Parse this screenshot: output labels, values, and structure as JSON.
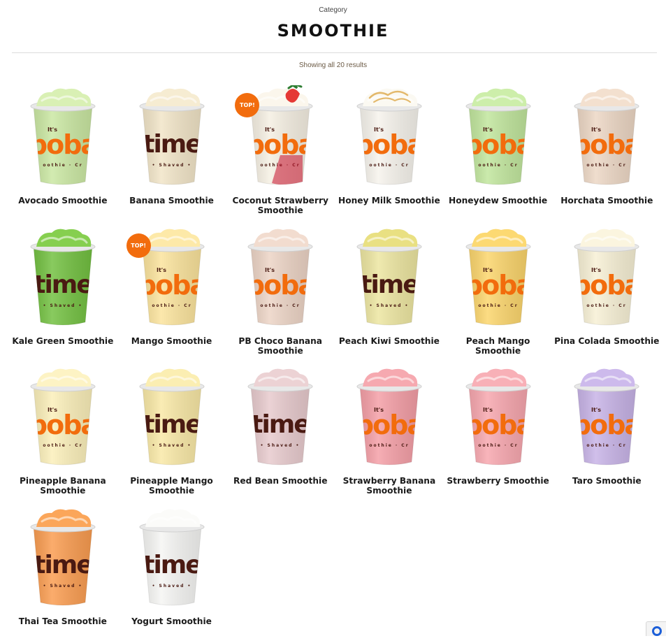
{
  "header": {
    "eyebrow": "Category",
    "title": "SMOOTHIE",
    "results": "Showing all 20 results"
  },
  "brand": {
    "accent": "#f26c0d",
    "dark_brown": "#4a1a12"
  },
  "products": [
    {
      "name": "Avocado Smoothie",
      "color": "#c9e7a0",
      "foam": "#d9f0b4",
      "print": "boba"
    },
    {
      "name": "Banana Smoothie",
      "color": "#f1e4c6",
      "foam": "#f6ecd2",
      "print": "time"
    },
    {
      "name": "Coconut Strawberry Smoothie",
      "color": "#f5efe2",
      "foam": "#fbf6ec",
      "print": "boba",
      "badge": "TOP!",
      "topping": "strawberry"
    },
    {
      "name": "Honey Milk Smoothie",
      "color": "#f6f3ec",
      "foam": "#fbf9f2",
      "print": "boba",
      "topping": "cream"
    },
    {
      "name": "Honeydew Smoothie",
      "color": "#bfe59a",
      "foam": "#cdeeaa",
      "print": "boba"
    },
    {
      "name": "Horchata Smoothie",
      "color": "#ecd6c3",
      "foam": "#f3e0cf",
      "print": "boba"
    },
    {
      "name": "Kale Green Smoothie",
      "color": "#6fbf3c",
      "foam": "#86cf4f",
      "print": "time"
    },
    {
      "name": "Mango Smoothie",
      "color": "#fbe39a",
      "foam": "#fde9a8",
      "print": "boba",
      "badge": "TOP!"
    },
    {
      "name": "PB Choco Banana Smoothie",
      "color": "#ecd3c4",
      "foam": "#f2dccf",
      "print": "boba"
    },
    {
      "name": "Peach Kiwi Smoothie",
      "color": "#ece59e",
      "foam": "#e9e082",
      "print": "time"
    },
    {
      "name": "Peach Mango Smoothie",
      "color": "#fbd468",
      "foam": "#fcd972",
      "print": "boba"
    },
    {
      "name": "Pina Colada Smoothie",
      "color": "#f7f0d4",
      "foam": "#fbf5df",
      "print": "boba"
    },
    {
      "name": "Pineapple Banana Smoothie",
      "color": "#fbefb8",
      "foam": "#fdf3c4",
      "print": "boba"
    },
    {
      "name": "Pineapple Mango Smoothie",
      "color": "#f9e8a4",
      "foam": "#fbeeb2",
      "print": "time"
    },
    {
      "name": "Red Bean Smoothie",
      "color": "#e7c9cc",
      "foam": "#ecd2d4",
      "print": "time"
    },
    {
      "name": "Strawberry Banana Smoothie",
      "color": "#f49ca4",
      "foam": "#f6a9b0",
      "print": "boba"
    },
    {
      "name": "Strawberry Smoothie",
      "color": "#f7a4ac",
      "foam": "#f8b0b7",
      "print": "boba"
    },
    {
      "name": "Taro Smoothie",
      "color": "#c6b1e6",
      "foam": "#cdbaec",
      "print": "boba"
    },
    {
      "name": "Thai Tea Smoothie",
      "color": "#fa9a4c",
      "foam": "#fba65a",
      "print": "time"
    },
    {
      "name": "Yogurt Smoothie",
      "color": "#f5f5f3",
      "foam": "#fbfbf9",
      "print": "time"
    }
  ]
}
